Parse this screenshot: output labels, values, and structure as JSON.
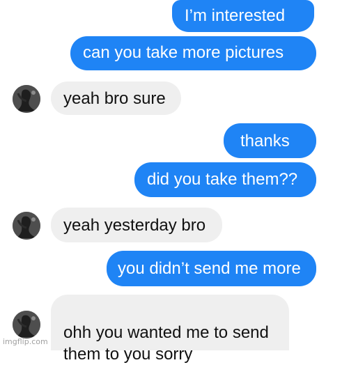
{
  "conversation": {
    "messages": [
      {
        "direction": "outgoing",
        "text": "I’m interested"
      },
      {
        "direction": "outgoing",
        "text": "can you take more pictures"
      },
      {
        "direction": "incoming",
        "text": "yeah bro sure",
        "avatar": "contact-avatar"
      },
      {
        "direction": "outgoing",
        "text": "thanks"
      },
      {
        "direction": "outgoing",
        "text": "did you take them??"
      },
      {
        "direction": "incoming",
        "text": "yeah yesterday bro",
        "avatar": "contact-avatar"
      },
      {
        "direction": "outgoing",
        "text": "you didn’t send me more"
      },
      {
        "direction": "incoming",
        "text": "ohh you wanted me to send\nthem to you sorry",
        "avatar": "contact-avatar"
      }
    ]
  },
  "watermark": "imgflip.com",
  "colors": {
    "outgoing_bubble": "#1f84f5",
    "incoming_bubble": "#efefef",
    "outgoing_text": "#ffffff",
    "incoming_text": "#111111"
  }
}
